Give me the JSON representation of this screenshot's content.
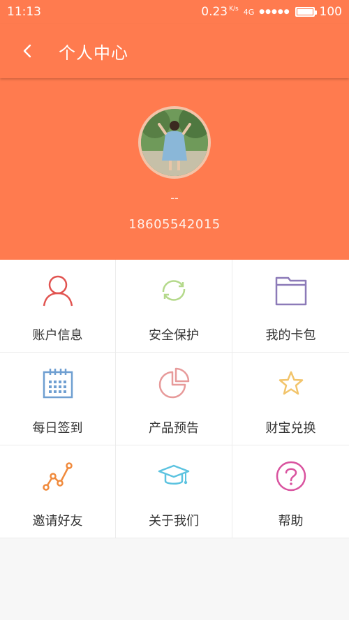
{
  "status_bar": {
    "time": "11:13",
    "speed": "0.23",
    "speed_unit": "K/s",
    "network": "4G",
    "battery": "100"
  },
  "header": {
    "title": "个人中心",
    "back_icon": "chevron-left-icon"
  },
  "profile": {
    "nickname": "--",
    "phone": "18605542015"
  },
  "menu": [
    {
      "label": "账户信息",
      "icon": "user-icon",
      "color": "#e15350"
    },
    {
      "label": "安全保护",
      "icon": "refresh-icon",
      "color": "#b4d98b"
    },
    {
      "label": "我的卡包",
      "icon": "folder-icon",
      "color": "#8c7ab8"
    },
    {
      "label": "每日签到",
      "icon": "calendar-icon",
      "color": "#6f9fd1"
    },
    {
      "label": "产品预告",
      "icon": "pie-chart-icon",
      "color": "#e79a9a"
    },
    {
      "label": "财宝兑换",
      "icon": "star-icon",
      "color": "#f2c46b"
    },
    {
      "label": "邀请好友",
      "icon": "trend-line-icon",
      "color": "#f08a3c"
    },
    {
      "label": "关于我们",
      "icon": "graduation-cap-icon",
      "color": "#5cc3e0"
    },
    {
      "label": "帮助",
      "icon": "help-circle-icon",
      "color": "#d9539f"
    }
  ],
  "colors": {
    "accent": "#ff7b4f",
    "background": "#f7f7f7"
  }
}
